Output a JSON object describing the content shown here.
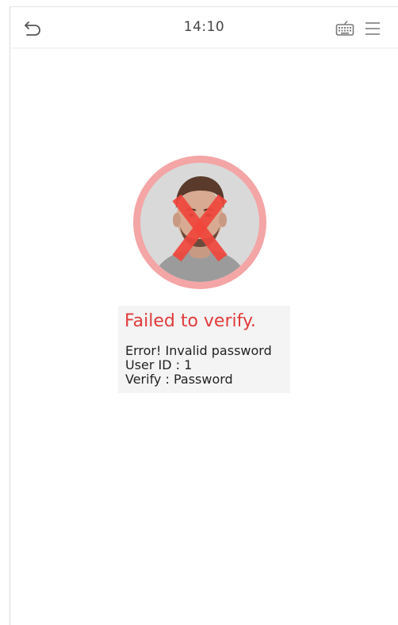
{
  "status_bar": {
    "time": "14:10",
    "back_icon": "back-arrow-icon",
    "keyboard_icon": "keyboard-icon",
    "menu_icon": "hamburger-menu-icon"
  },
  "verification": {
    "avatar_icon": "user-face-photo",
    "status_icon": "red-x-icon",
    "title": "Failed to verify.",
    "error": "Error! Invalid password",
    "user_id": "User ID : 1",
    "verify_mode": "Verify : Password"
  },
  "colors": {
    "error_red": "#e23b3b",
    "ring_pink": "#f4a5a5",
    "card_background": "#f4f4f4"
  }
}
